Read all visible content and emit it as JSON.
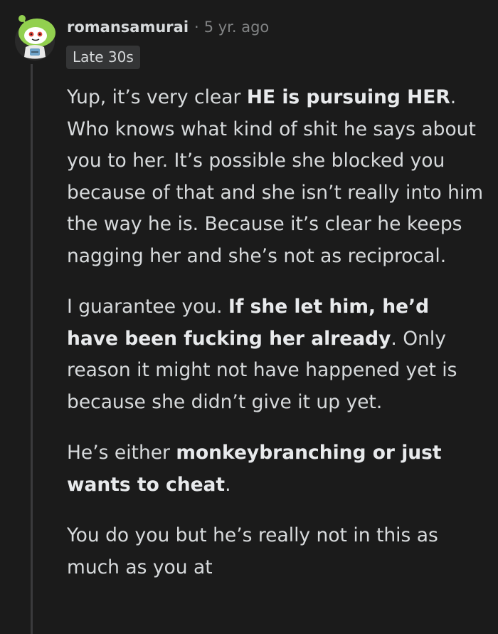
{
  "comment": {
    "username": "romansamurai",
    "separator": "·",
    "timestamp": "5 yr. ago",
    "flair": "Late 30s",
    "paragraphs": [
      {
        "segments": [
          {
            "text": "Yup, it’s very clear ",
            "bold": false
          },
          {
            "text": "HE is pursuing HER",
            "bold": true
          },
          {
            "text": ". Who knows what kind of shit he says about you to her. It’s possible she blocked you because of that and she isn’t really into him the way he is. Because it’s clear he keeps nagging her and she’s not as reciprocal.",
            "bold": false
          }
        ]
      },
      {
        "segments": [
          {
            "text": "I guarantee you. ",
            "bold": false
          },
          {
            "text": "If she let him, he’d have been fucking her already",
            "bold": true
          },
          {
            "text": ". Only reason it might not have happened yet is because she didn’t give it up yet.",
            "bold": false
          }
        ]
      },
      {
        "segments": [
          {
            "text": "He’s either ",
            "bold": false
          },
          {
            "text": "monkeybranching or just wants to cheat",
            "bold": true
          },
          {
            "text": ".",
            "bold": false
          }
        ]
      },
      {
        "segments": [
          {
            "text": "You do you but he’s really not in this as much as you at",
            "bold": false
          }
        ]
      }
    ]
  },
  "colors": {
    "background": "#1b1b1b",
    "text": "#d7dadc",
    "meta": "#818384",
    "flair_bg": "#343536",
    "thread_line": "#3a3a3c",
    "avatar_green": "#92d04f"
  },
  "icons": {
    "avatar": "snoo-avatar-icon"
  }
}
